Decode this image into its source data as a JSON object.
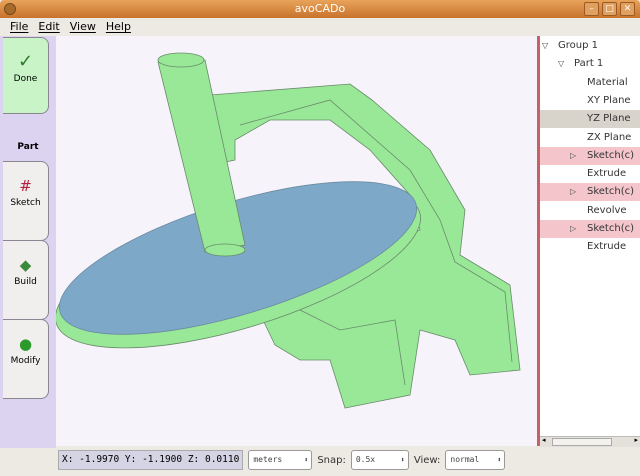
{
  "window": {
    "title": "avoCADo",
    "buttons": [
      "minimize",
      "maximize",
      "close"
    ]
  },
  "menu": [
    "File",
    "Edit",
    "View",
    "Help"
  ],
  "toolbar": {
    "done": "Done",
    "section": "Part",
    "sketch": "Sketch",
    "build": "Build",
    "modify": "Modify"
  },
  "tree": [
    {
      "label": "Group 1",
      "expander": "▽",
      "state": "normal"
    },
    {
      "label": "Part 1",
      "expander": "▽",
      "state": "normal"
    },
    {
      "label": "Material",
      "state": "normal"
    },
    {
      "label": "XY Plane",
      "state": "normal"
    },
    {
      "label": "YZ Plane",
      "state": "selected"
    },
    {
      "label": "ZX Plane",
      "state": "normal"
    },
    {
      "label": "Sketch(c)",
      "expander": "▷",
      "state": "highlight"
    },
    {
      "label": "Extrude",
      "state": "normal"
    },
    {
      "label": "Sketch(c)",
      "expander": "▷",
      "state": "highlight"
    },
    {
      "label": "Revolve",
      "state": "normal"
    },
    {
      "label": "Sketch(c)",
      "expander": "▷",
      "state": "highlight"
    },
    {
      "label": "Extrude",
      "state": "normal"
    }
  ],
  "status": {
    "coords": "X: -1.9970  Y: -1.1900  Z:  0.0110",
    "units": "meters",
    "snap_label": "Snap:",
    "snap": "0.5x",
    "view_label": "View:",
    "view": "normal"
  },
  "colors": {
    "solid": "#98e898",
    "plate": "#7ea8c8",
    "highlight": "#f4c6cc",
    "divider": "#c8606a"
  }
}
